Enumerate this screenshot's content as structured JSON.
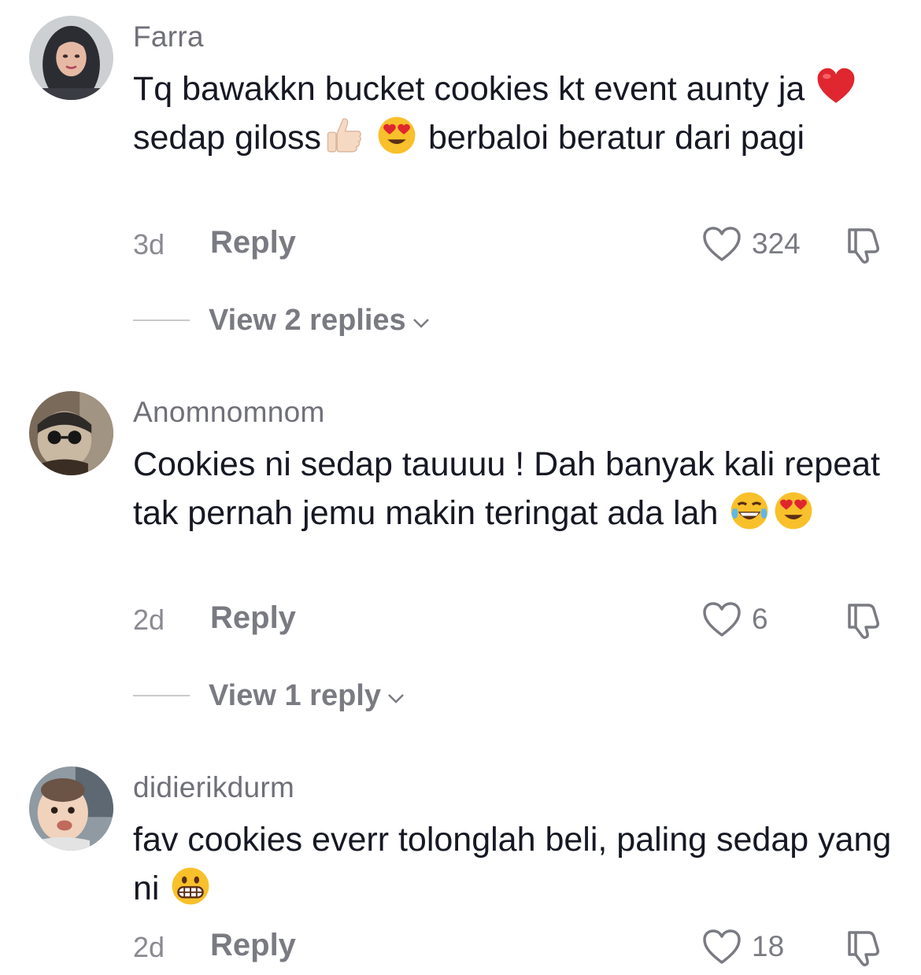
{
  "comments": [
    {
      "username": "Farra",
      "text_parts": [
        "Tq bawakkn bucket cookies kt event aunty ja ",
        "sedap giloss",
        " ",
        " berbaloi beratur dari pagi"
      ],
      "emojis": [
        "red-heart",
        "thumbs-up",
        "heart-eyes"
      ],
      "time": "3d",
      "reply_label": "Reply",
      "likes": "324",
      "view_replies": "View 2 replies"
    },
    {
      "username": "Anomnomnom",
      "text_parts": [
        "Cookies ni sedap tauuuu ! Dah banyak kali repeat tak pernah jemu makin teringat ada lah "
      ],
      "emojis": [
        "tears-of-joy",
        "heart-eyes"
      ],
      "time": "2d",
      "reply_label": "Reply",
      "likes": "6",
      "view_replies": "View 1 reply"
    },
    {
      "username": "didierikdurm",
      "text_parts": [
        "fav cookies everr tolonglah beli, paling sedap yang ni "
      ],
      "emojis": [
        "grimacing"
      ],
      "time": "2d",
      "reply_label": "Reply",
      "likes": "18"
    }
  ],
  "colors": {
    "text_primary": "#161823",
    "text_secondary": "#7a7b82",
    "divider": "#c8c9cc",
    "emoji_yellow": "#f8c02a",
    "heart_red": "#e0262f"
  }
}
